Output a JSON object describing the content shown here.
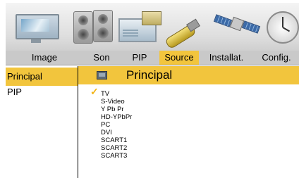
{
  "tabs": [
    {
      "label": "Image",
      "active": false
    },
    {
      "label": "Son",
      "active": false
    },
    {
      "label": "PIP",
      "active": false
    },
    {
      "label": "Source",
      "active": true
    },
    {
      "label": "Installat.",
      "active": false
    },
    {
      "label": "Config.",
      "active": false
    }
  ],
  "tab_icons": [
    "monitor-icon",
    "speaker-icon",
    "pip-icon",
    "connector-icon",
    "satellite-icon",
    "clock-icon"
  ],
  "sidebar": {
    "items": [
      {
        "label": "Principal",
        "active": true
      },
      {
        "label": "PIP",
        "active": false
      }
    ]
  },
  "panel": {
    "title": "Principal",
    "title_icon": "tv-icon",
    "options": [
      {
        "label": "TV",
        "selected": true
      },
      {
        "label": "S-Video",
        "selected": false
      },
      {
        "label": "Y Pb Pr",
        "selected": false
      },
      {
        "label": "HD-YPbPr",
        "selected": false
      },
      {
        "label": "PC",
        "selected": false
      },
      {
        "label": "DVI",
        "selected": false
      },
      {
        "label": "SCART1",
        "selected": false
      },
      {
        "label": "SCART2",
        "selected": false
      },
      {
        "label": "SCART3",
        "selected": false
      }
    ]
  },
  "colors": {
    "accent": "#f2c53d",
    "tab_bar": "#c9c9c9",
    "check": "#f2b416"
  }
}
